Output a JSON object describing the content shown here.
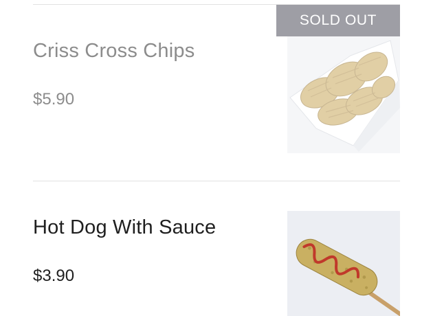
{
  "menu": {
    "items": [
      {
        "name": "Criss Cross Chips",
        "price": "$5.90",
        "badge": "SOLD OUT",
        "image_icon": "waffle-fries-image"
      },
      {
        "name": "Hot Dog With Sauce",
        "price": "$3.90",
        "image_icon": "corn-dog-image"
      }
    ]
  },
  "colors": {
    "sold_text": "#8c8c8c",
    "available_text": "#1f1f1f",
    "badge_bg": "#9e9ea5",
    "divider": "#e2e2e2"
  }
}
